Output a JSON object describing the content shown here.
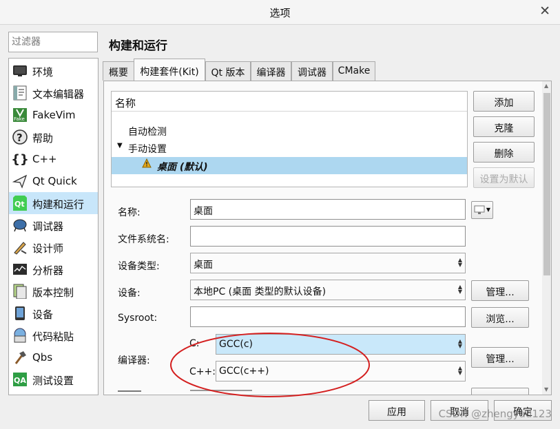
{
  "window": {
    "title": "选项"
  },
  "filter": {
    "placeholder": "过滤器"
  },
  "sidebar": {
    "items": [
      {
        "label": "环境",
        "icon": "monitor-icon"
      },
      {
        "label": "文本编辑器",
        "icon": "text-editor-icon"
      },
      {
        "label": "FakeVim",
        "icon": "fakevim-icon"
      },
      {
        "label": "帮助",
        "icon": "help-icon"
      },
      {
        "label": "C++",
        "icon": "cpp-braces-icon"
      },
      {
        "label": "Qt Quick",
        "icon": "qt-quick-icon"
      },
      {
        "label": "构建和运行",
        "icon": "build-run-icon",
        "selected": true
      },
      {
        "label": "调试器",
        "icon": "debugger-icon"
      },
      {
        "label": "设计师",
        "icon": "designer-icon"
      },
      {
        "label": "分析器",
        "icon": "analyzer-icon"
      },
      {
        "label": "版本控制",
        "icon": "version-control-icon"
      },
      {
        "label": "设备",
        "icon": "device-icon"
      },
      {
        "label": "代码粘贴",
        "icon": "code-paste-icon"
      },
      {
        "label": "Qbs",
        "icon": "qbs-hammer-icon"
      },
      {
        "label": "测试设置",
        "icon": "qa-test-icon"
      }
    ]
  },
  "page": {
    "title": "构建和运行"
  },
  "tabs": [
    "概要",
    "构建套件(Kit)",
    "Qt 版本",
    "编译器",
    "调试器",
    "CMake"
  ],
  "active_tab": "构建套件(Kit)",
  "kit_tree": {
    "header": "名称",
    "auto": "自动检测",
    "manual": "手动设置",
    "kit": "桌面 (默认)"
  },
  "kit_buttons": {
    "add": "添加",
    "clone": "克隆",
    "remove": "删除",
    "make_default": "设置为默认"
  },
  "form": {
    "name_label": "名称:",
    "name_value": "桌面",
    "fs_label": "文件系统名:",
    "fs_value": "",
    "device_type_label": "设备类型:",
    "device_type_value": "桌面",
    "device_label": "设备:",
    "device_value": "本地PC (桌面 类型的默认设备)",
    "device_manage": "管理...",
    "sysroot_label": "Sysroot:",
    "sysroot_value": "",
    "browse": "浏览...",
    "compiler_label": "编译器:",
    "c_label": "C:",
    "c_value": "GCC(c)",
    "cpp_label": "C++:",
    "cpp_value": "GCC(c++)",
    "compiler_manage": "管理..."
  },
  "footer": {
    "apply": "应用",
    "cancel": "取消",
    "ok": "确定"
  },
  "watermark": "CSDN @zhengyad123",
  "colors": {
    "selection": "#add7f0",
    "annotation": "#d42020",
    "warning": "#e3a81a"
  }
}
